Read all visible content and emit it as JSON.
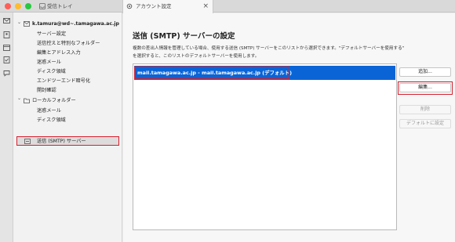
{
  "tabs": [
    {
      "label": "受信トレイ"
    },
    {
      "label": "アカウント設定"
    }
  ],
  "folders": {
    "account": "k.tamura@wd~.tamagawa.ac.jp",
    "account_items": [
      "サーバー設定",
      "送信控えと特別なフォルダー",
      "編集とアドレス入力",
      "迷惑メール",
      "ディスク領域",
      "エンドツーエンド暗号化",
      "開封確認"
    ],
    "local": "ローカルフォルダー",
    "local_items": [
      "迷惑メール",
      "ディスク領域"
    ],
    "smtp": "送信 (SMTP) サーバー"
  },
  "main": {
    "heading": "送信 (SMTP) サーバーの設定",
    "desc_line1": "複数の差出人情報を管理している場合、使用する送信 (SMTP) サーバーをこのリストから選択できます。\"デフォルトサーバーを使用する\"",
    "desc_line2": "を選択すると、このリストのデフォルトサーバーを使用します。",
    "server_item": "mail.tamagawa.ac.jp - mail.tamagawa.ac.jp (デフォルト)"
  },
  "buttons": {
    "add": "追加...",
    "edit": "編集...",
    "remove": "削除",
    "set_default": "デフォルトに設定"
  },
  "colors": {
    "selection": "#0a64d6",
    "annotation": "#d5202e"
  }
}
